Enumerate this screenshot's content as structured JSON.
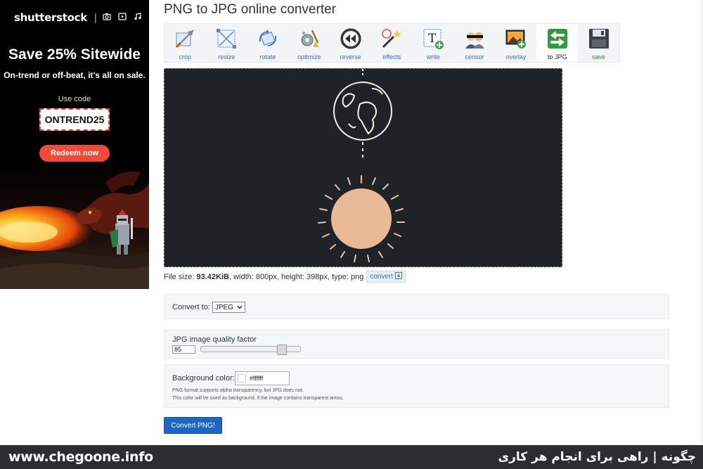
{
  "ad": {
    "logo": "shutterstock",
    "separator": "|",
    "headline": "Save 25% Sitewide",
    "subheadline": "On-trend or off-beat, it’s all on sale.",
    "use_code_label": "Use code",
    "code": "ONTREND25",
    "cta": "Redeem now",
    "accent": "#f04b3a"
  },
  "page": {
    "title": "PNG to JPG online converter"
  },
  "toolbar": {
    "tools": [
      {
        "label": "crop",
        "icon": "crop-icon"
      },
      {
        "label": "resize",
        "icon": "resize-icon"
      },
      {
        "label": "rotate",
        "icon": "rotate-icon"
      },
      {
        "label": "optimize",
        "icon": "optimize-icon"
      },
      {
        "label": "reverse",
        "icon": "reverse-icon"
      },
      {
        "label": "effects",
        "icon": "effects-icon"
      },
      {
        "label": "write",
        "icon": "write-icon"
      },
      {
        "label": "censor",
        "icon": "censor-icon"
      },
      {
        "label": "overlay",
        "icon": "overlay-icon"
      },
      {
        "label": "to JPG",
        "icon": "to-jpg-icon",
        "active": true
      },
      {
        "label": "save",
        "icon": "save-icon"
      }
    ]
  },
  "fileinfo": {
    "prefix": "File size: ",
    "size": "93.42KiB",
    "details": ", width: 800px, height: 398px, type: png",
    "convert_label": "convert"
  },
  "convert_to": {
    "label": "Convert to:",
    "selected": "JPEG"
  },
  "quality": {
    "label": "JPG image quality factor",
    "value": "85",
    "fraction": 0.85
  },
  "background": {
    "label": "Background color:",
    "value": "#ffffff",
    "note1": "PNG format supports alpha transparency, but JPG does not.",
    "note2": "This color will be used as background, if the image contains transparent areas."
  },
  "actions": {
    "convert_button": "Convert PNG!"
  },
  "footer": {
    "site": "www.chegoone.info",
    "tagline": "چگونه | راهی برای انجام هر کاری"
  }
}
